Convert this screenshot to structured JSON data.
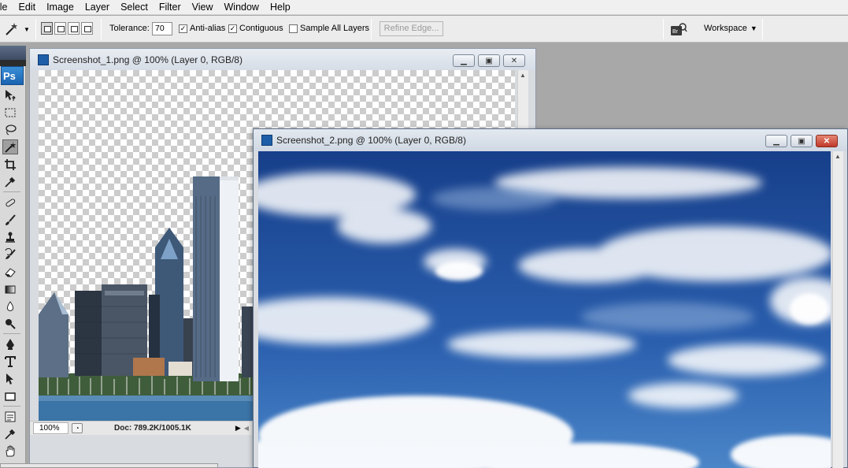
{
  "menu": [
    "ile",
    "Edit",
    "Image",
    "Layer",
    "Select",
    "Filter",
    "View",
    "Window",
    "Help"
  ],
  "options": {
    "tolerance_label": "Tolerance:",
    "tolerance_value": "70",
    "anti_alias_label": "Anti-alias",
    "contiguous_label": "Contiguous",
    "sample_all_label": "Sample All Layers",
    "anti_alias_checked": true,
    "contiguous_checked": true,
    "sample_all_checked": false,
    "refine_label": "Refine Edge...",
    "workspace_label": "Workspace",
    "check_mark": "✓"
  },
  "tools": {
    "logo": "Ps",
    "items": [
      "move-icon",
      "marquee-icon",
      "lasso-icon",
      "magic-wand-icon",
      "crop-icon",
      "eyedropper-icon",
      "healing-brush-icon",
      "brush-icon",
      "clone-stamp-icon",
      "history-brush-icon",
      "eraser-icon",
      "gradient-icon",
      "blur-icon",
      "dodge-icon",
      "pen-icon",
      "type-icon",
      "path-selection-icon",
      "rectangle-icon",
      "notes-icon",
      "eyedropper2-icon",
      "hand-icon"
    ],
    "active": "magic-wand-icon"
  },
  "window1": {
    "title": "Screenshot_1.png @ 100% (Layer 0, RGB/8)",
    "zoom": "100%",
    "doc_info": "Doc: 789.2K/1005.1K"
  },
  "window2": {
    "title": "Screenshot_2.png @ 100% (Layer 0, RGB/8)"
  },
  "colors": {
    "sky_dark": "#1a4a96",
    "sky_mid": "#2f67b4",
    "window_frame": "#8f9aa8",
    "close_red": "#c0392b",
    "active_tool": "#9f9f9f"
  }
}
